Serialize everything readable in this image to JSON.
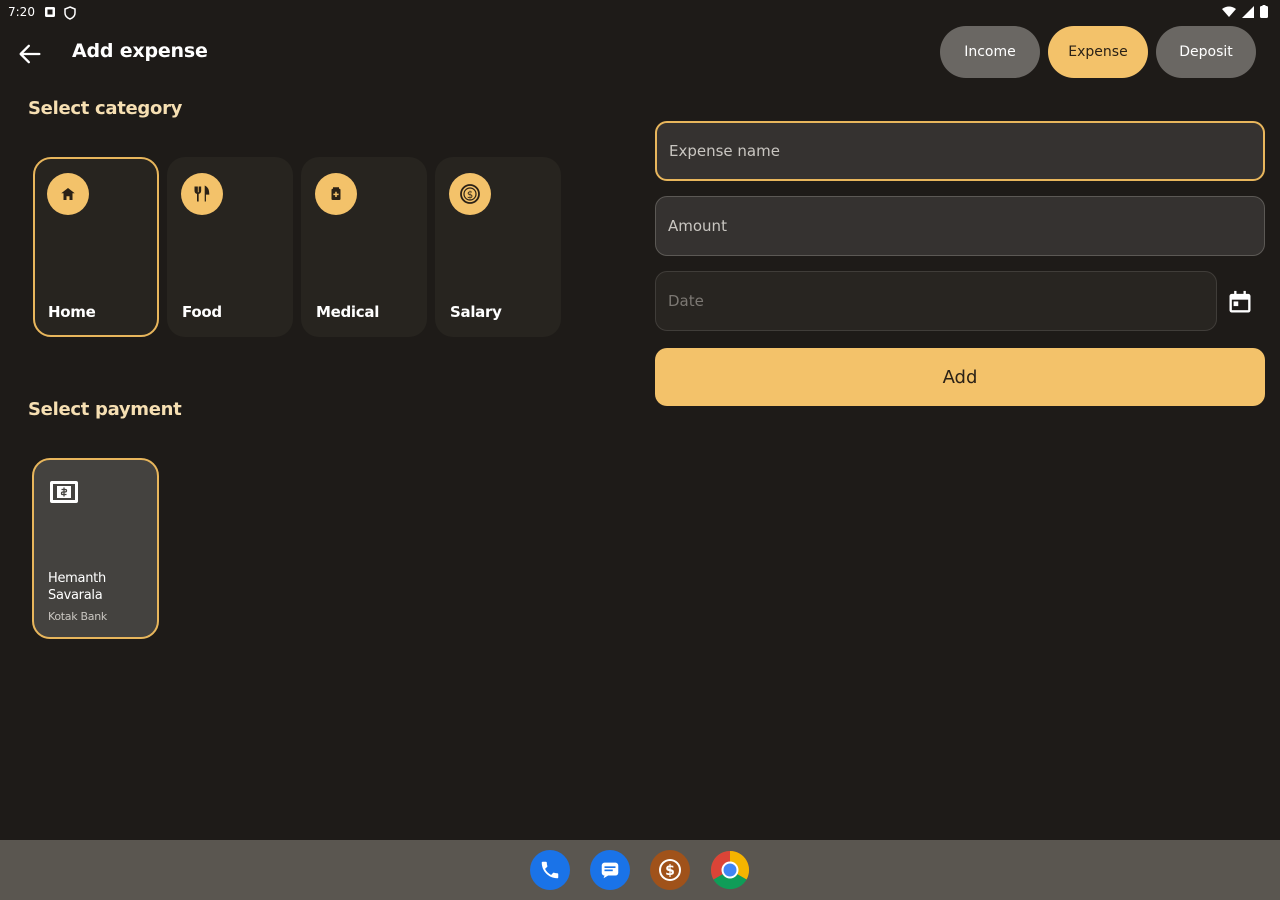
{
  "status_bar": {
    "time": "7:20"
  },
  "header": {
    "title": "Add expense"
  },
  "type_chips": [
    {
      "label": "Income",
      "active": false
    },
    {
      "label": "Expense",
      "active": true
    },
    {
      "label": "Deposit",
      "active": false
    }
  ],
  "category": {
    "heading": "Select category",
    "items": [
      {
        "label": "Home",
        "icon": "home-icon",
        "selected": true
      },
      {
        "label": "Food",
        "icon": "restaurant-icon",
        "selected": false
      },
      {
        "label": "Medical",
        "icon": "medical-icon",
        "selected": false
      },
      {
        "label": "Salary",
        "icon": "dollar-coin-icon",
        "selected": false
      }
    ]
  },
  "payment": {
    "heading": "Select payment",
    "cards": [
      {
        "name": "Hemanth Savarala",
        "bank": "Kotak Bank",
        "icon": "payment-card-icon"
      }
    ]
  },
  "form": {
    "expense_name_placeholder": "Expense name",
    "amount_placeholder": "Amount",
    "date_placeholder": "Date",
    "add_label": "Add"
  },
  "colors": {
    "accent": "#f3c26a",
    "background": "#1e1b18",
    "card": "#27241f",
    "taskbar": "#5a5650"
  },
  "taskbar": {
    "apps": [
      "phone-icon",
      "messages-icon",
      "money-app-icon",
      "chrome-icon"
    ]
  }
}
